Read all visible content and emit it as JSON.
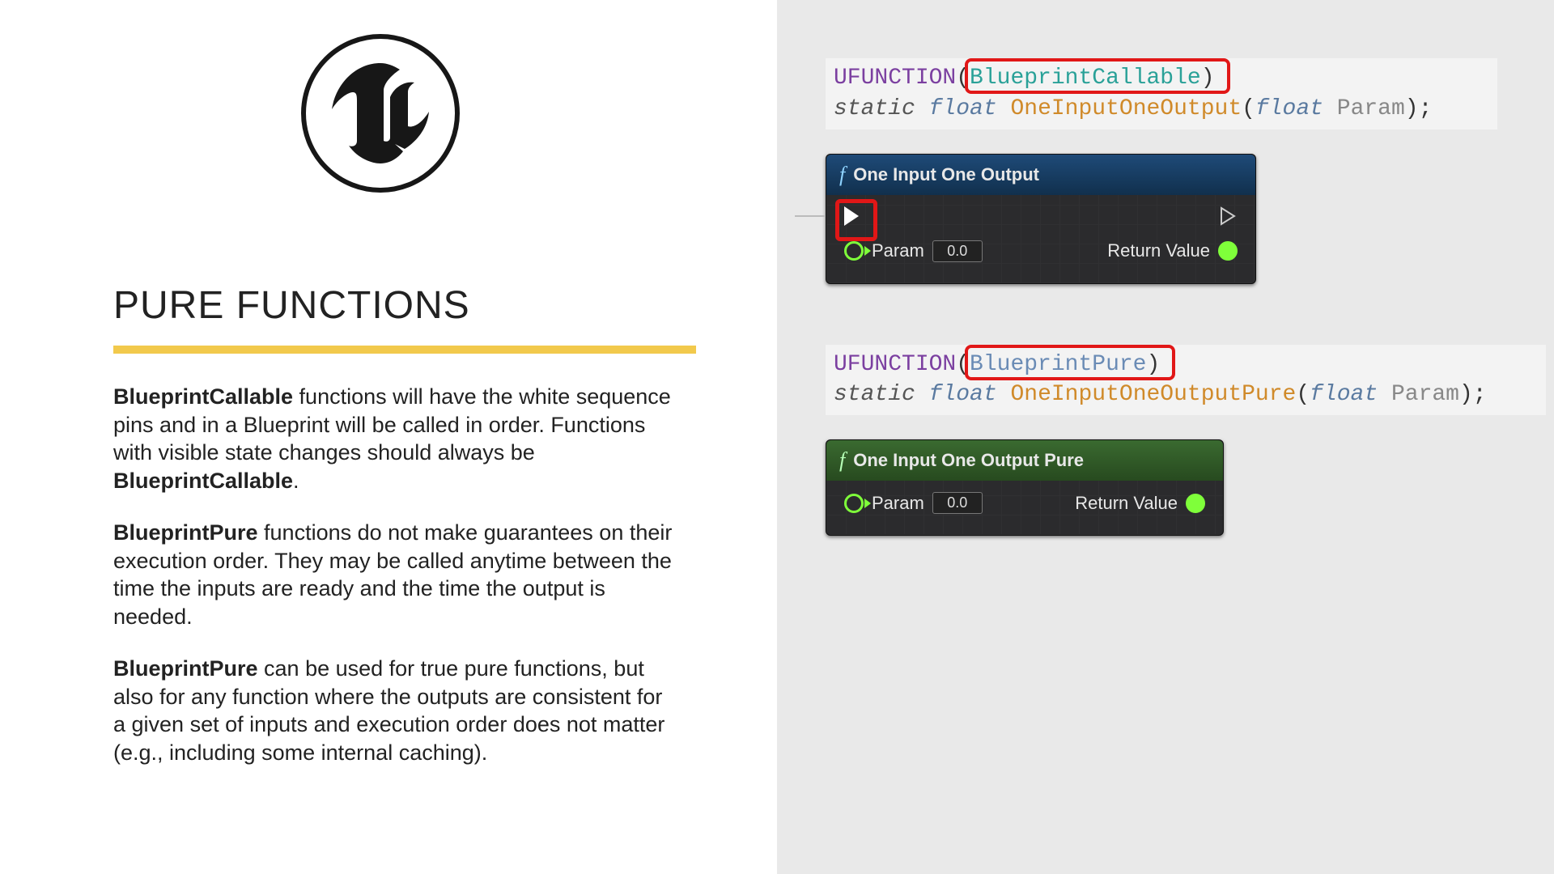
{
  "heading": "PURE FUNCTIONS",
  "paragraphs": {
    "p1_b1": "BlueprintCallable",
    "p1_t1": " functions will have the white sequence pins and in a Blueprint will be called in order. Functions with visible state changes should always be ",
    "p1_b2": "BlueprintCallable",
    "p1_t2": ".",
    "p2_b1": "BlueprintPure",
    "p2_t1": " functions do not make guarantees on their execution order. They may be called anytime between the time the inputs are ready and the time the output is needed.",
    "p3_b1": "BlueprintPure",
    "p3_t1": " can be used for true pure functions, but also for any function where the outputs are consistent for a given set of inputs and execution order does not matter (e.g., including some internal caching)."
  },
  "code1": {
    "macro": "UFUNCTION",
    "spec": "BlueprintCallable",
    "kw_static": "static",
    "kw_float": "float",
    "fn": "OneInputOneOutput",
    "ptype": "float",
    "pname": "Param"
  },
  "node1": {
    "title": "One Input One Output",
    "param_label": "Param",
    "param_value": "0.0",
    "return_label": "Return Value"
  },
  "code2": {
    "macro": "UFUNCTION",
    "spec": "BlueprintPure",
    "kw_static": "static",
    "kw_float": "float",
    "fn": "OneInputOneOutputPure",
    "ptype": "float",
    "pname": "Param"
  },
  "node2": {
    "title": "One Input One Output Pure",
    "param_label": "Param",
    "param_value": "0.0",
    "return_label": "Return Value"
  }
}
